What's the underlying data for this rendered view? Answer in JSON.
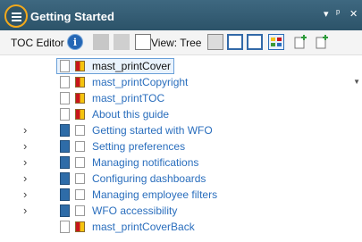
{
  "window": {
    "title": "Getting Started",
    "controls": {
      "dropdown": "▾",
      "pin": "ᵖ",
      "close": "✕"
    }
  },
  "toolbar": {
    "label": "TOC Editor",
    "view_label": "View: Tree",
    "icons": [
      "info-icon",
      "copy-icon",
      "paste-icon",
      "edit-icon",
      "view-icon",
      "toc-icon",
      "add-page-icon",
      "replace-page-icon",
      "flag-icon",
      "properties-icon",
      "new-icon"
    ]
  },
  "tree": {
    "items": [
      {
        "label": "mast_printCover",
        "type": "page",
        "flag": "conditional",
        "selected": true,
        "expandable": false
      },
      {
        "label": "mast_printCopyright",
        "type": "page",
        "flag": "conditional",
        "selected": false,
        "expandable": false
      },
      {
        "label": "mast_printTOC",
        "type": "page",
        "flag": "conditional",
        "selected": false,
        "expandable": false
      },
      {
        "label": "About this guide",
        "type": "page",
        "flag": "conditional",
        "selected": false,
        "expandable": false
      },
      {
        "label": "Getting started with WFO",
        "type": "book",
        "flag": "none",
        "selected": false,
        "expandable": true
      },
      {
        "label": "Setting preferences",
        "type": "book",
        "flag": "none",
        "selected": false,
        "expandable": true
      },
      {
        "label": "Managing notifications",
        "type": "book",
        "flag": "none",
        "selected": false,
        "expandable": true
      },
      {
        "label": "Configuring dashboards",
        "type": "book",
        "flag": "none",
        "selected": false,
        "expandable": true
      },
      {
        "label": "Managing employee filters",
        "type": "book",
        "flag": "none",
        "selected": false,
        "expandable": true
      },
      {
        "label": "WFO accessibility",
        "type": "book",
        "flag": "none",
        "selected": false,
        "expandable": true
      },
      {
        "label": "mast_printCoverBack",
        "type": "page",
        "flag": "conditional",
        "selected": false,
        "expandable": false
      }
    ]
  },
  "colors": {
    "titlebar": "#2c5369",
    "highlight": "#f3a91b",
    "link": "#2a6ebd"
  }
}
